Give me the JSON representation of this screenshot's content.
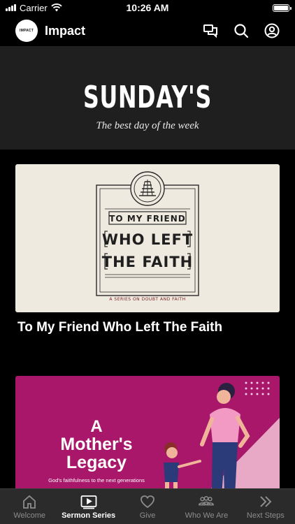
{
  "status_bar": {
    "carrier": "Carrier",
    "time": "10:26 AM"
  },
  "header": {
    "logo_text": "IMPACT",
    "app_title": "Impact",
    "icons": [
      "messages-icon",
      "search-icon",
      "account-icon"
    ]
  },
  "hero": {
    "title": "SUNDAY'S",
    "subtitle": "The best day of the week"
  },
  "cards": [
    {
      "title": "To My Friend Who Left The Faith",
      "art": {
        "line1": "TO MY FRIEND",
        "line2": "WHO LEFT",
        "line3": "THE FAITH",
        "caption": "A SERIES ON DOUBT AND FAITH"
      }
    },
    {
      "title": "",
      "art": {
        "line1": "A",
        "line2": "Mother's",
        "line3": "Legacy",
        "caption": "God's faithfulness to the next generations"
      }
    }
  ],
  "tabs": [
    {
      "label": "Welcome",
      "icon": "home-icon",
      "active": false
    },
    {
      "label": "Sermon Series",
      "icon": "video-play-icon",
      "active": true
    },
    {
      "label": "Give",
      "icon": "heart-icon",
      "active": false
    },
    {
      "label": "Who We Are",
      "icon": "people-icon",
      "active": false
    },
    {
      "label": "Next Steps",
      "icon": "double-chevron-right-icon",
      "active": false
    }
  ],
  "colors": {
    "background": "#000000",
    "hero_background": "#1f1f1f",
    "tab_bar": "#2b2b2b",
    "tab_inactive": "#8d8d8d",
    "card1_bg": "#efeadf",
    "card2_bg": "#a8176a"
  }
}
